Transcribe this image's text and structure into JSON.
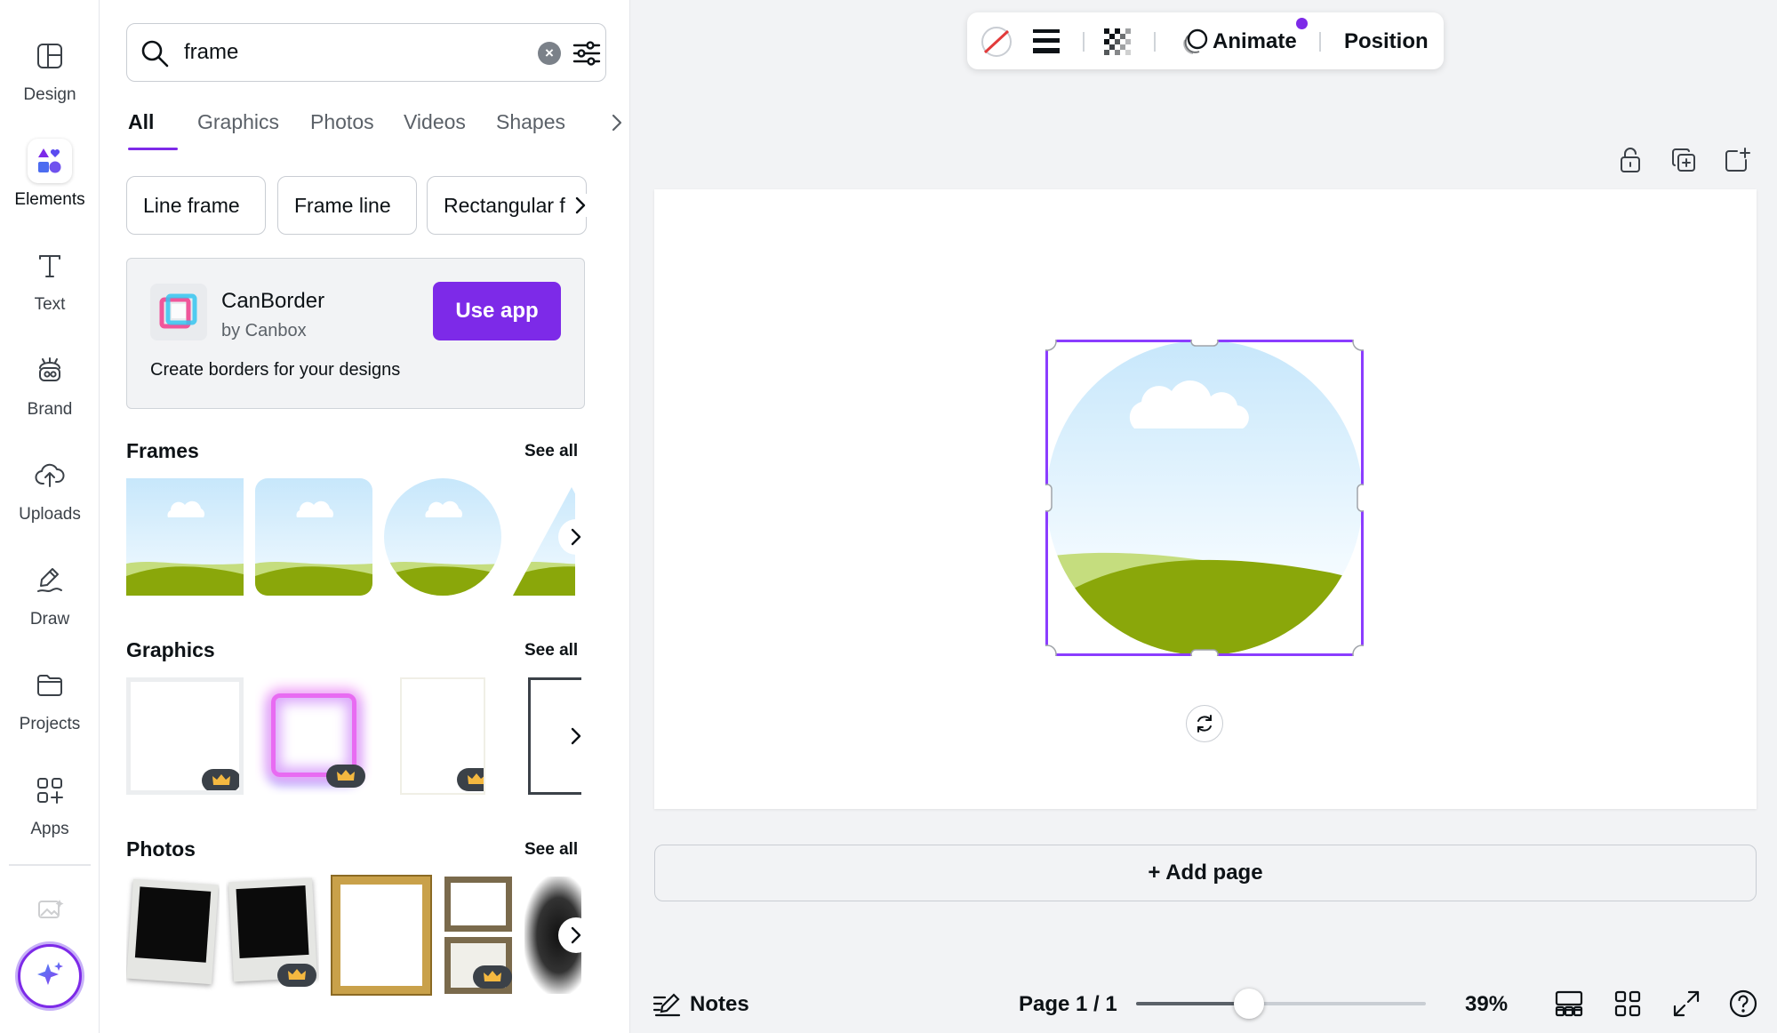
{
  "colors": {
    "accent": "#7d2ae8",
    "hill_light": "#c5dd7e",
    "hill_dark": "#8aa70a",
    "sky_top": "#c7e7fb"
  },
  "rail": {
    "items": [
      {
        "label": "Design",
        "icon": "design-icon"
      },
      {
        "label": "Elements",
        "icon": "elements-icon",
        "active": true
      },
      {
        "label": "Text",
        "icon": "text-icon"
      },
      {
        "label": "Brand",
        "icon": "brand-icon"
      },
      {
        "label": "Uploads",
        "icon": "uploads-icon"
      },
      {
        "label": "Draw",
        "icon": "draw-icon"
      },
      {
        "label": "Projects",
        "icon": "projects-icon"
      },
      {
        "label": "Apps",
        "icon": "apps-icon"
      }
    ]
  },
  "search": {
    "value": "frame"
  },
  "tabs": [
    "All",
    "Graphics",
    "Photos",
    "Videos",
    "Shapes"
  ],
  "chips": [
    "Line frame",
    "Frame line",
    "Rectangular f"
  ],
  "app_card": {
    "name": "CanBorder",
    "vendor": "by Canbox",
    "button": "Use app",
    "description": "Create borders for your designs"
  },
  "sections": {
    "frames": {
      "title": "Frames",
      "see_all": "See all"
    },
    "graphics": {
      "title": "Graphics",
      "see_all": "See all"
    },
    "photos": {
      "title": "Photos",
      "see_all": "See all"
    }
  },
  "toolbar": {
    "animate": "Animate",
    "position": "Position"
  },
  "canvas": {
    "add_page": "+ Add page"
  },
  "bottom_bar": {
    "notes": "Notes",
    "page_indicator": "Page 1 / 1",
    "zoom": "39%",
    "zoom_level": 0.39
  }
}
